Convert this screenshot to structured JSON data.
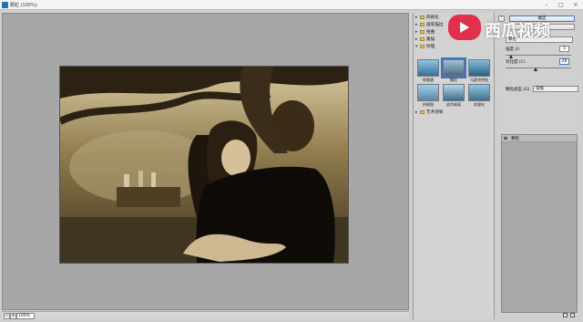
{
  "titlebar": {
    "title": "颗粒 (100%)"
  },
  "statusbar": {
    "zoom_minus": "−",
    "zoom_plus": "+",
    "zoom_value": "100%"
  },
  "gallery": {
    "categories": [
      {
        "arrow": "▸",
        "label": "风格化"
      },
      {
        "arrow": "▸",
        "label": "画笔描边"
      },
      {
        "arrow": "▸",
        "label": "扭曲"
      },
      {
        "arrow": "▸",
        "label": "素描"
      },
      {
        "arrow": "▾",
        "label": "纹理"
      }
    ],
    "bottom_category": {
      "arrow": "▸",
      "label": "艺术效果"
    },
    "thumbs": [
      "龟裂缝",
      "颗粒",
      "马赛克拼贴",
      "拼缀图",
      "染色玻璃",
      "纹理化"
    ]
  },
  "settings": {
    "ok_label": "确定",
    "cancel_label": "取消",
    "filter_select": "颗粒",
    "intensity_label": "强度 (I)",
    "intensity_value": "5",
    "contrast_label": "对比度 (C)",
    "contrast_value": "28",
    "grain_type_label": "颗粒类型 (G)",
    "grain_type_value": "常规"
  },
  "layers": {
    "row_name": "颗粒"
  },
  "watermark": {
    "text": "西瓜视频"
  }
}
